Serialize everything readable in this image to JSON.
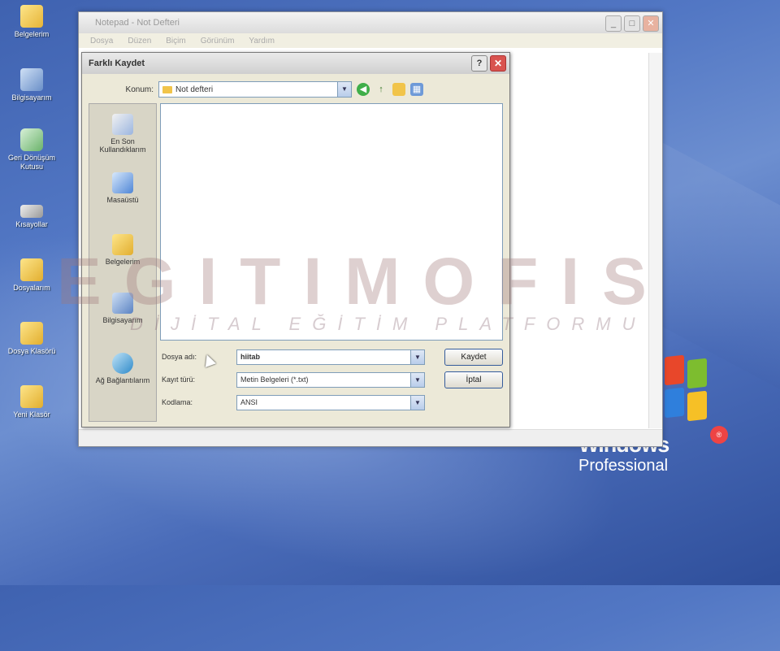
{
  "desktop": {
    "icons": [
      {
        "label": "Belgelerim",
        "icon": "folder-docs-icon"
      },
      {
        "label": "Bilgisayarım",
        "icon": "computer-icon"
      },
      {
        "label": "Geri Dönüşüm Kutusu",
        "icon": "recycle-bin-icon"
      },
      {
        "label": "Kısayollar",
        "icon": "drive-icon"
      },
      {
        "label": "Dosyalarım",
        "icon": "folder-icon"
      },
      {
        "label": "Dosya Klasörü",
        "icon": "folder-icon"
      },
      {
        "label": "Yeni Klasör",
        "icon": "folder-icon"
      }
    ],
    "windows_logo": {
      "brand": "Windows",
      "edition": "Professional",
      "tm": "®"
    }
  },
  "notepad": {
    "title": "Notepad - Not Defteri",
    "menu": [
      "Dosya",
      "Düzen",
      "Biçim",
      "Görünüm",
      "Yardım"
    ]
  },
  "dialog": {
    "title": "Farklı Kaydet",
    "help": "?",
    "close": "✕",
    "location_label": "Konum:",
    "location_value": "Not defteri",
    "places": [
      {
        "label": "En Son Kullandıklarım",
        "icon": "recent-icon"
      },
      {
        "label": "Masaüstü",
        "icon": "desktop-icon"
      },
      {
        "label": "Belgelerim",
        "icon": "documents-icon"
      },
      {
        "label": "Bilgisayarım",
        "icon": "computer-icon"
      },
      {
        "label": "Ağ Bağlantılarım",
        "icon": "network-icon"
      }
    ],
    "filename_label": "Dosya adı:",
    "filename_value": "hiitab",
    "filetype_label": "Kayıt türü:",
    "filetype_value": "Metin Belgeleri (*.txt)",
    "encoding_label": "Kodlama:",
    "encoding_value": "ANSI",
    "save_button": "Kaydet",
    "cancel_button": "İptal"
  },
  "watermark": {
    "main": "EGITIMOFIS",
    "sub": "DİJİTAL EĞİTİM PLATFORMU"
  },
  "colors": {
    "accent": "#355c9c",
    "desktop": "#4a6cb9"
  }
}
